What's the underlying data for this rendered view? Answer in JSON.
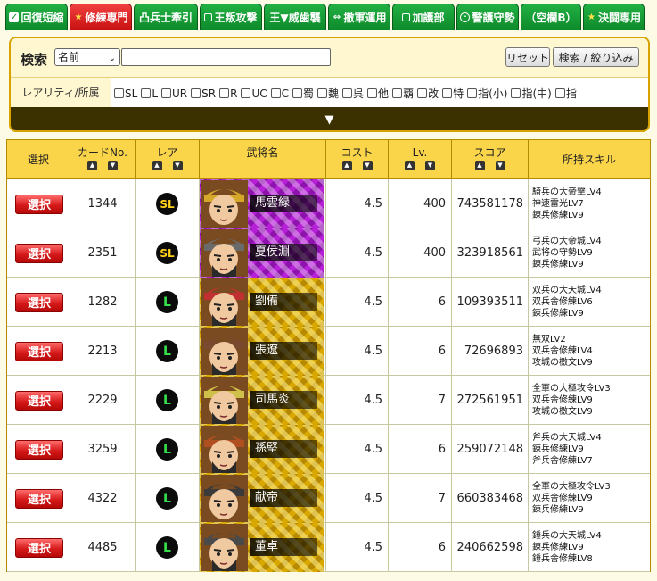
{
  "tabs": [
    {
      "label": "回復短縮",
      "icon": "check-icon",
      "active": false
    },
    {
      "label": "修練専門",
      "icon": "star-icon",
      "active": true
    },
    {
      "label": "凸兵士牽引",
      "icon": "",
      "active": false
    },
    {
      "label": "王叛攻撃",
      "icon": "box-icon",
      "active": false
    },
    {
      "label": "王▼威歯襲",
      "icon": "",
      "active": false
    },
    {
      "label": "撤軍運用",
      "icon": "arrows-icon",
      "active": false
    },
    {
      "label": "加護部",
      "icon": "box-icon",
      "active": false
    },
    {
      "label": "警護守勢",
      "icon": "circle-icon",
      "active": false
    },
    {
      "label": "（空欄B）",
      "icon": "",
      "active": false
    },
    {
      "label": "決闘専用",
      "icon": "star-icon",
      "active": false
    }
  ],
  "search": {
    "label": "検索",
    "field_selected": "名前",
    "input_value": "",
    "reset_label": "リセット",
    "filter_label": "検索 / 絞り込み"
  },
  "rarity_filter": {
    "label": "レアリティ/所属",
    "options": [
      "SL",
      "L",
      "UR",
      "SR",
      "R",
      "UC",
      "C",
      "蜀",
      "魏",
      "呉",
      "他",
      "覇",
      "改",
      "特",
      "指(小)",
      "指(中)",
      "指"
    ]
  },
  "expand_icon": "▼",
  "table": {
    "headers": {
      "select": "選択",
      "card_no": "カードNo.",
      "rarity": "レア",
      "name": "武将名",
      "cost": "コスト",
      "level": "Lv.",
      "score": "スコア",
      "skills": "所持スキル"
    },
    "select_label": "選択",
    "rows": [
      {
        "card_no": "1344",
        "rarity": "SL",
        "name": "馬雲緑",
        "cost": "4.5",
        "level": "400",
        "score": "743581178",
        "skills": [
          "騎兵の大帝撃LV4",
          "神速雷光LV7",
          "錬兵修練LV9"
        ]
      },
      {
        "card_no": "2351",
        "rarity": "SL",
        "name": "夏侯淵",
        "cost": "4.5",
        "level": "400",
        "score": "323918561",
        "skills": [
          "弓兵の大帝城LV4",
          "武将の守勢LV9",
          "錬兵修練LV9"
        ]
      },
      {
        "card_no": "1282",
        "rarity": "L",
        "name": "劉備",
        "cost": "4.5",
        "level": "6",
        "score": "109393511",
        "skills": [
          "双兵の大天城LV4",
          "双兵舎修練LV6",
          "錬兵修練LV9"
        ]
      },
      {
        "card_no": "2213",
        "rarity": "L",
        "name": "張遼",
        "cost": "4.5",
        "level": "6",
        "score": "72696893",
        "skills": [
          "無双LV2",
          "双兵舎修練LV4",
          "攻城の檄文LV9"
        ]
      },
      {
        "card_no": "2229",
        "rarity": "L",
        "name": "司馬炎",
        "cost": "4.5",
        "level": "7",
        "score": "272561951",
        "skills": [
          "全軍の大極攻令LV3",
          "双兵舎修練LV9",
          "攻城の檄文LV9"
        ]
      },
      {
        "card_no": "3259",
        "rarity": "L",
        "name": "孫堅",
        "cost": "4.5",
        "level": "6",
        "score": "259072148",
        "skills": [
          "斧兵の大天城LV4",
          "錬兵修練LV9",
          "斧兵舎修練LV7"
        ]
      },
      {
        "card_no": "4322",
        "rarity": "L",
        "name": "献帝",
        "cost": "4.5",
        "level": "7",
        "score": "660383468",
        "skills": [
          "全軍の大極攻令LV3",
          "双兵舎修練LV9",
          "錬兵修練LV9"
        ]
      },
      {
        "card_no": "4485",
        "rarity": "L",
        "name": "董卓",
        "cost": "4.5",
        "level": "6",
        "score": "240662598",
        "skills": [
          "錘兵の大天城LV4",
          "錬兵修練LV9",
          "錘兵舎修練LV8"
        ]
      }
    ]
  },
  "colors": {
    "tab_green": "#0e8a2a",
    "tab_active_red": "#c81010",
    "header_yellow": "#fad54a",
    "select_button_red": "#d61a1a",
    "panel_border": "#d8a200"
  }
}
